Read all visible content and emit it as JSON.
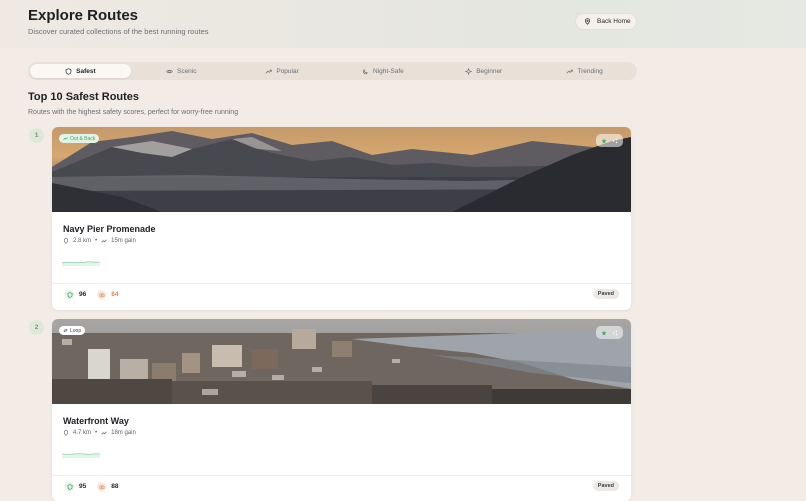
{
  "header": {
    "title": "Explore Routes",
    "subtitle": "Discover curated collections of the best running routes",
    "back_label": "Back Home"
  },
  "tabs": [
    {
      "label": "Safest",
      "icon": "shield-icon",
      "active": true
    },
    {
      "label": "Scenic",
      "icon": "eye-icon",
      "active": false
    },
    {
      "label": "Popular",
      "icon": "trending-icon",
      "active": false
    },
    {
      "label": "Night-Safe",
      "icon": "moon-icon",
      "active": false
    },
    {
      "label": "Beginner",
      "icon": "sparkle-icon",
      "active": false
    },
    {
      "label": "Trending",
      "icon": "trending-icon",
      "active": false
    }
  ],
  "section": {
    "title": "Top 10 Safest Routes",
    "subtitle": "Routes with the highest safety scores, perfect for worry-free running"
  },
  "routes": [
    {
      "rank": "1",
      "type_label": "Out & Back",
      "type_color": "#3fa86b",
      "name": "Navy Pier Promenade",
      "distance": "2.8 km",
      "gain": "15m gain",
      "safety": "96",
      "scenic": "84",
      "scenic_color": "#e0855a",
      "surface": "Paved"
    },
    {
      "rank": "2",
      "type_label": "Loop",
      "type_color": "#3b3f44",
      "name": "Waterfront Way",
      "distance": "4.7 km",
      "gain": "18m gain",
      "safety": "95",
      "scenic": "88",
      "scenic_color": "#3b3f44",
      "surface": "Paved"
    }
  ],
  "colors": {
    "accent_green": "#3fa86b",
    "background": "#f3ece6"
  }
}
